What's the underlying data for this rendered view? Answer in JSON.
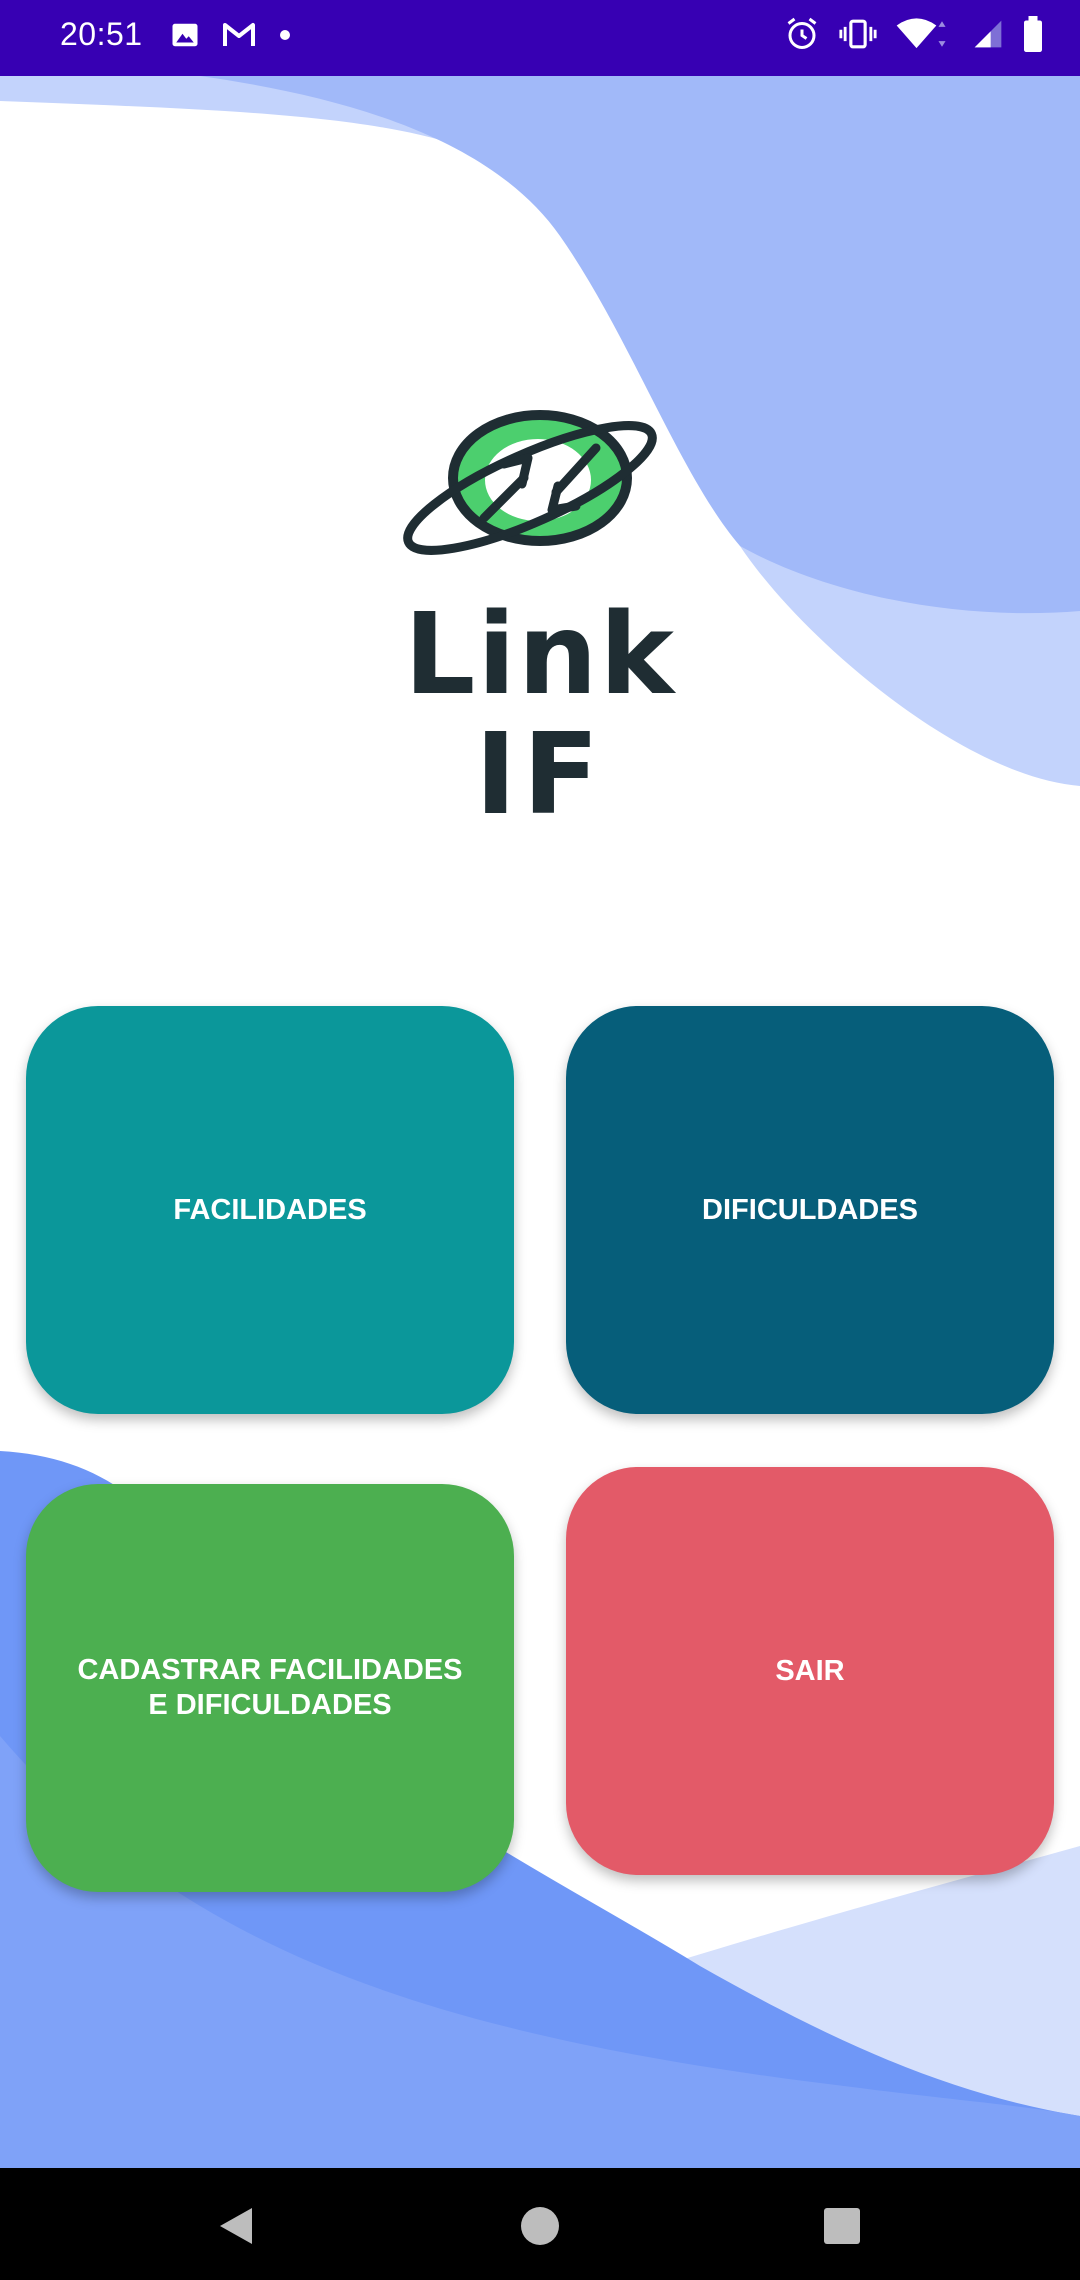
{
  "status_bar": {
    "time": "20:51",
    "left_icons": [
      "image-icon",
      "gmail-icon",
      "dot-icon"
    ],
    "right_icons": [
      "alarm-icon",
      "vibrate-icon",
      "wifi-icon",
      "signal-icon",
      "battery-icon"
    ]
  },
  "logo": {
    "line1": "Link",
    "line2": "IF",
    "colors": {
      "ring": "#4ccf6e",
      "outline": "#1f2d33"
    }
  },
  "tiles": {
    "facilidades": {
      "label": "FACILIDADES",
      "color": "#0b979a"
    },
    "dificuldades": {
      "label": "DIFICULDADES",
      "color": "#065e7a"
    },
    "cadastrar": {
      "label": "CADASTRAR FACILIDADES E DIFICULDADES",
      "color": "#4caf50"
    },
    "sair": {
      "label": "SAIR",
      "color": "#e35a68"
    }
  },
  "nav_bar": {
    "buttons": [
      "back-icon",
      "home-icon",
      "recent-apps-icon"
    ]
  },
  "colors": {
    "status_bar": "#3700b3",
    "wave_dark": "#6f97f7",
    "wave_mid": "#a1b9f9",
    "wave_light": "#d5e0fc"
  }
}
